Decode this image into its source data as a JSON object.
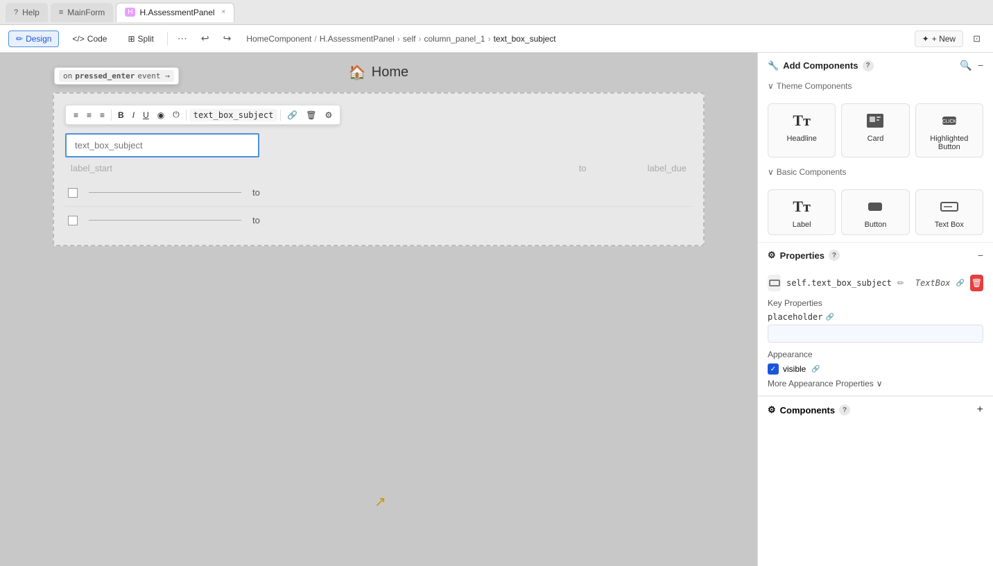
{
  "tabs": [
    {
      "id": "help",
      "label": "Help",
      "icon": "?",
      "active": false
    },
    {
      "id": "mainform",
      "label": "MainForm",
      "icon": "≡",
      "active": false
    },
    {
      "id": "assessment",
      "label": "H.AssessmentPanel",
      "icon": "H",
      "active": true,
      "closeable": true
    }
  ],
  "toolbar": {
    "design_label": "Design",
    "code_label": "Code",
    "split_label": "Split",
    "new_label": "+ New",
    "undo_icon": "↩",
    "redo_icon": "↪",
    "more_icon": "⋯"
  },
  "breadcrumb": {
    "parts": [
      "HomeComponent",
      "H.AssessmentPanel",
      "self",
      "column_panel_1",
      "text_box_subject"
    ]
  },
  "canvas": {
    "home_title": "Home",
    "home_icon": "🏠"
  },
  "floating_toolbar": {
    "event_label": "on pressed_enter event →",
    "component_name": "text_box_subject",
    "align_left": "≡",
    "align_center": "≡",
    "align_right": "≡",
    "bold": "B",
    "italic": "I",
    "underline": "U",
    "visibility": "◉",
    "power": "⏻",
    "link_icon": "🔗",
    "delete_icon": "🗑",
    "settings_icon": "⚙"
  },
  "form": {
    "text_box_placeholder": "text_box_subject",
    "label_start": "label_start",
    "to_label": "to",
    "label_due": "label_due",
    "checkbox_rows": [
      {
        "id": 1,
        "to": "to"
      },
      {
        "id": 2,
        "to": "to"
      }
    ]
  },
  "right_panel": {
    "add_components_title": "Add Components",
    "theme_components_title": "Theme Components",
    "basic_components_title": "Basic Components",
    "theme_components": [
      {
        "id": "headline",
        "label": "Headline",
        "icon": "T"
      },
      {
        "id": "card",
        "label": "Card",
        "icon": "⊞"
      },
      {
        "id": "highlighted_button",
        "label": "Highlighted Button",
        "icon": "☞"
      }
    ],
    "basic_components": [
      {
        "id": "label",
        "label": "Label",
        "icon": "T"
      },
      {
        "id": "button",
        "label": "Button",
        "icon": "☞"
      },
      {
        "id": "text_box",
        "label": "Text Box",
        "icon": "▭"
      }
    ],
    "properties_title": "Properties",
    "component_name": "self.text_box_subject",
    "component_type": "TextBox",
    "key_properties_title": "Key Properties",
    "placeholder_label": "placeholder",
    "placeholder_value": "",
    "appearance_title": "Appearance",
    "visible_label": "visible",
    "more_appearance_label": "More Appearance Properties",
    "components_title": "Components"
  }
}
